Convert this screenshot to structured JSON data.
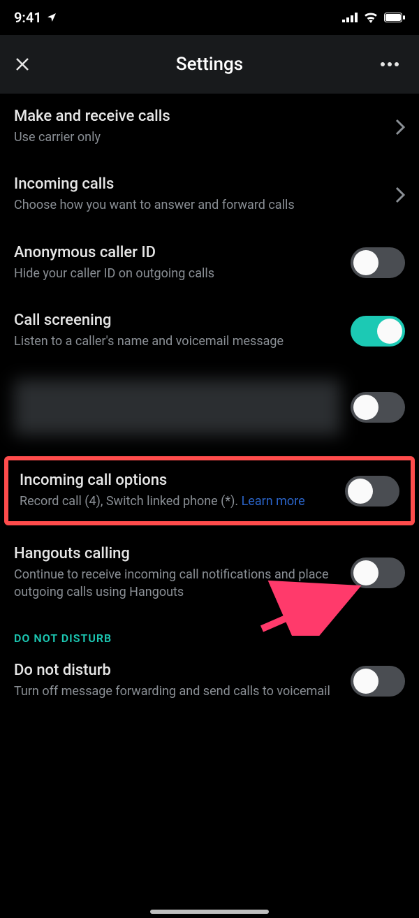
{
  "statusbar": {
    "time": "9:41"
  },
  "header": {
    "title": "Settings"
  },
  "rows": {
    "makeCalls": {
      "title": "Make and receive calls",
      "sub": "Use carrier only"
    },
    "incomingCalls": {
      "title": "Incoming calls",
      "sub": "Choose how you want to answer and forward calls"
    },
    "anonCaller": {
      "title": "Anonymous caller ID",
      "sub": "Hide your caller ID on outgoing calls"
    },
    "callScreening": {
      "title": "Call screening",
      "sub": "Listen to a caller's name and voicemail message"
    },
    "incomingOptions": {
      "title": "Incoming call options",
      "sub": "Record call (4), Switch linked phone (*). ",
      "link": "Learn more"
    },
    "hangouts": {
      "title": "Hangouts calling",
      "sub": "Continue to receive incoming call notifications and place outgoing calls using Hangouts"
    },
    "dnd": {
      "title": "Do not disturb",
      "sub": "Turn off message forwarding and send calls to voicemail"
    }
  },
  "sections": {
    "dnd": "DO NOT DISTURB"
  }
}
